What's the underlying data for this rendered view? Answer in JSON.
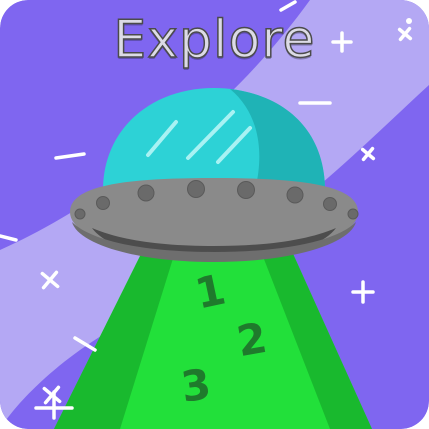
{
  "app_tile": {
    "title": "Explore",
    "beam_digits": [
      "1",
      "2",
      "3"
    ],
    "icons": {
      "main": "ufo-icon",
      "decor": "sparkle-icon"
    }
  },
  "colors": {
    "background": "#7f66f0",
    "swirl": "#b4a8f4",
    "dome": "#2dd2d6",
    "dome_shade": "#1fb3b6",
    "saucer": "#8a8a8a",
    "saucer_dark": "#5f5f5f",
    "beam": "#22e03a",
    "beam_shade": "#19b92e",
    "digit": "#1f7a2c",
    "title_fill": "#dcdbe6",
    "title_stroke": "#4b4b4b"
  }
}
